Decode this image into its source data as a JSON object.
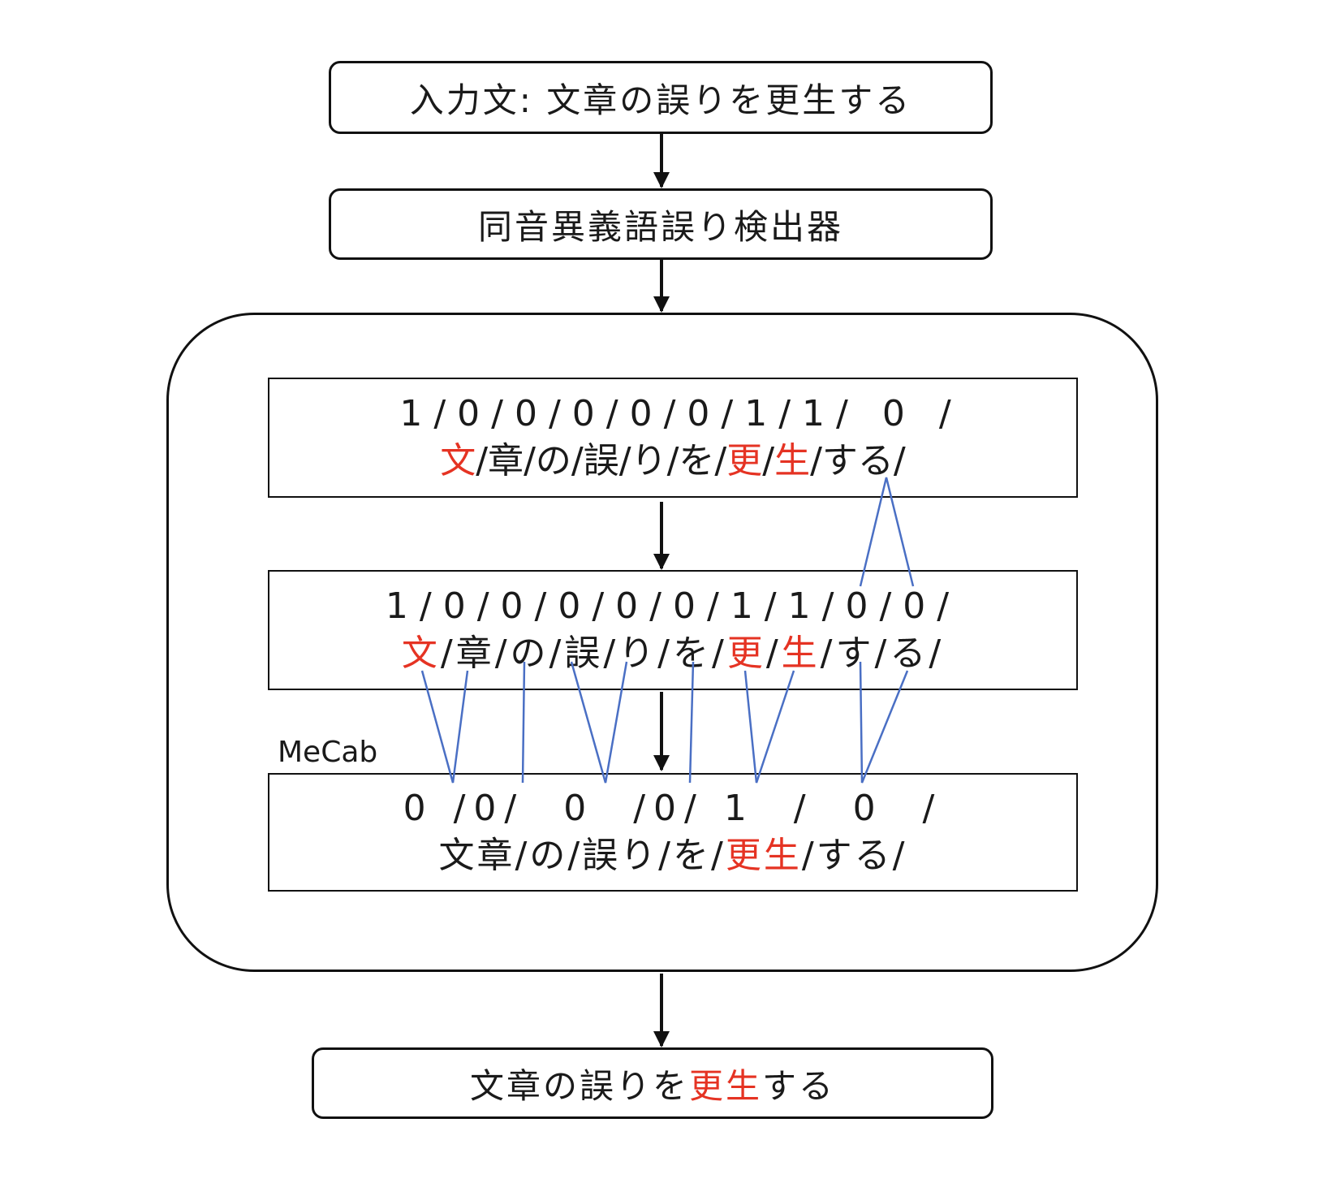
{
  "input_box": {
    "text": "入力文: 文章の誤りを更生する"
  },
  "detector_box": {
    "text": "同音異義語誤り検出器"
  },
  "stage1": {
    "labels": "1/0/0/0/0/0/1/1/ 0 /",
    "tokens": [
      {
        "t": "文",
        "red": true
      },
      {
        "t": "/",
        "red": false
      },
      {
        "t": "章",
        "red": false
      },
      {
        "t": "/",
        "red": false
      },
      {
        "t": "の",
        "red": false
      },
      {
        "t": "/",
        "red": false
      },
      {
        "t": "誤",
        "red": false
      },
      {
        "t": "/",
        "red": false
      },
      {
        "t": "り",
        "red": false
      },
      {
        "t": "/",
        "red": false
      },
      {
        "t": "を",
        "red": false
      },
      {
        "t": "/",
        "red": false
      },
      {
        "t": "更",
        "red": true
      },
      {
        "t": "/",
        "red": false
      },
      {
        "t": "生",
        "red": true
      },
      {
        "t": "/",
        "red": false
      },
      {
        "t": "する",
        "red": false
      },
      {
        "t": "/",
        "red": false
      }
    ]
  },
  "stage2": {
    "labels": "1/0/0/0/0/0/1/1/0/0/",
    "tokens": [
      {
        "t": "文",
        "red": true
      },
      {
        "t": "/",
        "red": false
      },
      {
        "t": "章",
        "red": false
      },
      {
        "t": "/",
        "red": false
      },
      {
        "t": "の",
        "red": false
      },
      {
        "t": "/",
        "red": false
      },
      {
        "t": "誤",
        "red": false
      },
      {
        "t": "/",
        "red": false
      },
      {
        "t": "り",
        "red": false
      },
      {
        "t": "/",
        "red": false
      },
      {
        "t": "を",
        "red": false
      },
      {
        "t": "/",
        "red": false
      },
      {
        "t": "更",
        "red": true
      },
      {
        "t": "/",
        "red": false
      },
      {
        "t": "生",
        "red": true
      },
      {
        "t": "/",
        "red": false
      },
      {
        "t": "す",
        "red": false
      },
      {
        "t": "/",
        "red": false
      },
      {
        "t": "る",
        "red": false
      },
      {
        "t": "/",
        "red": false
      }
    ]
  },
  "stage3": {
    "mecab_label": "MeCab",
    "labels": "0 /0/  0  /0/ 1  /  0  /",
    "tokens": [
      {
        "t": "文章",
        "red": false
      },
      {
        "t": "/",
        "red": false
      },
      {
        "t": "の",
        "red": false
      },
      {
        "t": "/",
        "red": false
      },
      {
        "t": "誤り",
        "red": false
      },
      {
        "t": "/",
        "red": false
      },
      {
        "t": "を",
        "red": false
      },
      {
        "t": "/",
        "red": false
      },
      {
        "t": "更生",
        "red": true
      },
      {
        "t": "/",
        "red": false
      },
      {
        "t": "する",
        "red": false
      },
      {
        "t": "/",
        "red": false
      }
    ]
  },
  "output_box": {
    "tokens": [
      {
        "t": "文章の誤りを",
        "red": false
      },
      {
        "t": "更生",
        "red": true
      },
      {
        "t": "する",
        "red": false
      }
    ]
  },
  "colors": {
    "highlight": "#e53323",
    "connector": "#4a6fc4",
    "arrow": "#111111"
  }
}
